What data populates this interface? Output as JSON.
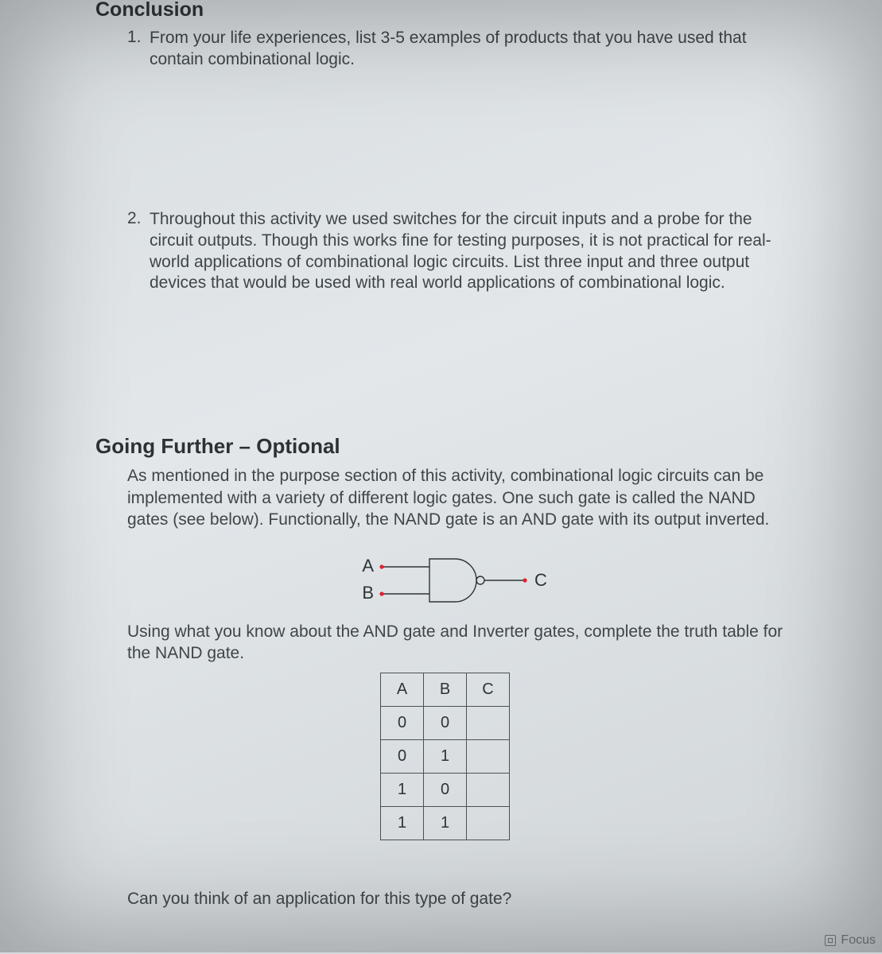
{
  "sections": {
    "conclusion": {
      "title": "Conclusion",
      "items": [
        {
          "num": "1.",
          "text": "From your life experiences, list 3-5 examples of products that you have used that contain combinational logic."
        },
        {
          "num": "2.",
          "text": "Throughout this activity we used switches for the circuit inputs and a probe for the circuit outputs. Though this works fine for testing purposes, it is not practical for real-world applications of combinational logic circuits. List three input and three output devices that would be used with real world applications of combinational logic."
        }
      ]
    },
    "going_further": {
      "title": "Going Further – Optional",
      "intro": "As mentioned in the purpose section of this activity, combinational logic circuits can be implemented with a variety of different logic gates. One such gate is called the NAND gates (see below). Functionally, the NAND gate is an AND gate with its output inverted.",
      "gate": {
        "inA": "A",
        "inB": "B",
        "out": "C"
      },
      "after_gate": "Using what you know about the AND gate and Inverter gates, complete the truth table for the NAND gate.",
      "truth_table": {
        "headers": [
          "A",
          "B",
          "C"
        ],
        "rows": [
          [
            "0",
            "0",
            ""
          ],
          [
            "0",
            "1",
            ""
          ],
          [
            "1",
            "0",
            ""
          ],
          [
            "1",
            "1",
            ""
          ]
        ]
      },
      "closing": "Can you think of an application for this type of gate?"
    }
  },
  "statusbar": {
    "focus": "Focus"
  }
}
